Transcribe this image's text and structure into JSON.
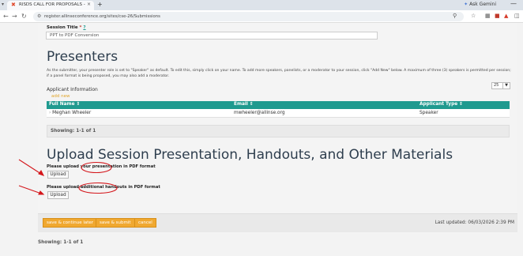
{
  "browser": {
    "tab_title": "RISDS CALL FOR PROPOSALS -",
    "new_tab": "+",
    "gemini_label": "Ask Gemini",
    "url": "register.allinseconference.org/sites/cse-26/Submissions"
  },
  "session": {
    "title_label": "Session Title",
    "required_marker": "*",
    "help_marker": "?",
    "title_value": "PPT to PDF Conversion"
  },
  "presenters": {
    "heading": "Presenters",
    "description": "As the submitter, your presenter role is set to \"Speaker\" as default. To edit this, simply click on your name. To add more speakers, panelists, or a moderator to your session, click \"Add New\" below. A maximum of three (3) speakers is permitted per session; if a panel format is being proposed, you may also add a moderator.",
    "applicant_info": "Applicant Information",
    "add_new": "add new",
    "per_page": "25",
    "columns": [
      "Full Name",
      "Email",
      "Applicant Type"
    ],
    "rows": [
      {
        "name": "Meghan Wheeler",
        "email": "mwheeler@allinse.org",
        "type": "Speaker"
      }
    ],
    "showing": "Showing: 1-1 of 1"
  },
  "upload": {
    "heading": "Upload Session Presentation, Handouts, and Other Materials",
    "presentation_label": "Please upload your presentation in PDF format",
    "handouts_label": "Please upload additional handouts in PDF format",
    "button_label": "Upload"
  },
  "footer": {
    "save_continue": "save & continue later",
    "save_submit": "save & submit",
    "cancel": "cancel",
    "last_updated": "Last updated: 06/03/2026 2:39 PM"
  },
  "bottom_showing": "Showing: 1-1 of 1",
  "colors": {
    "table_header": "#1f9a8f",
    "button_orange": "#f0a830",
    "annotation_red": "#d4161b"
  }
}
